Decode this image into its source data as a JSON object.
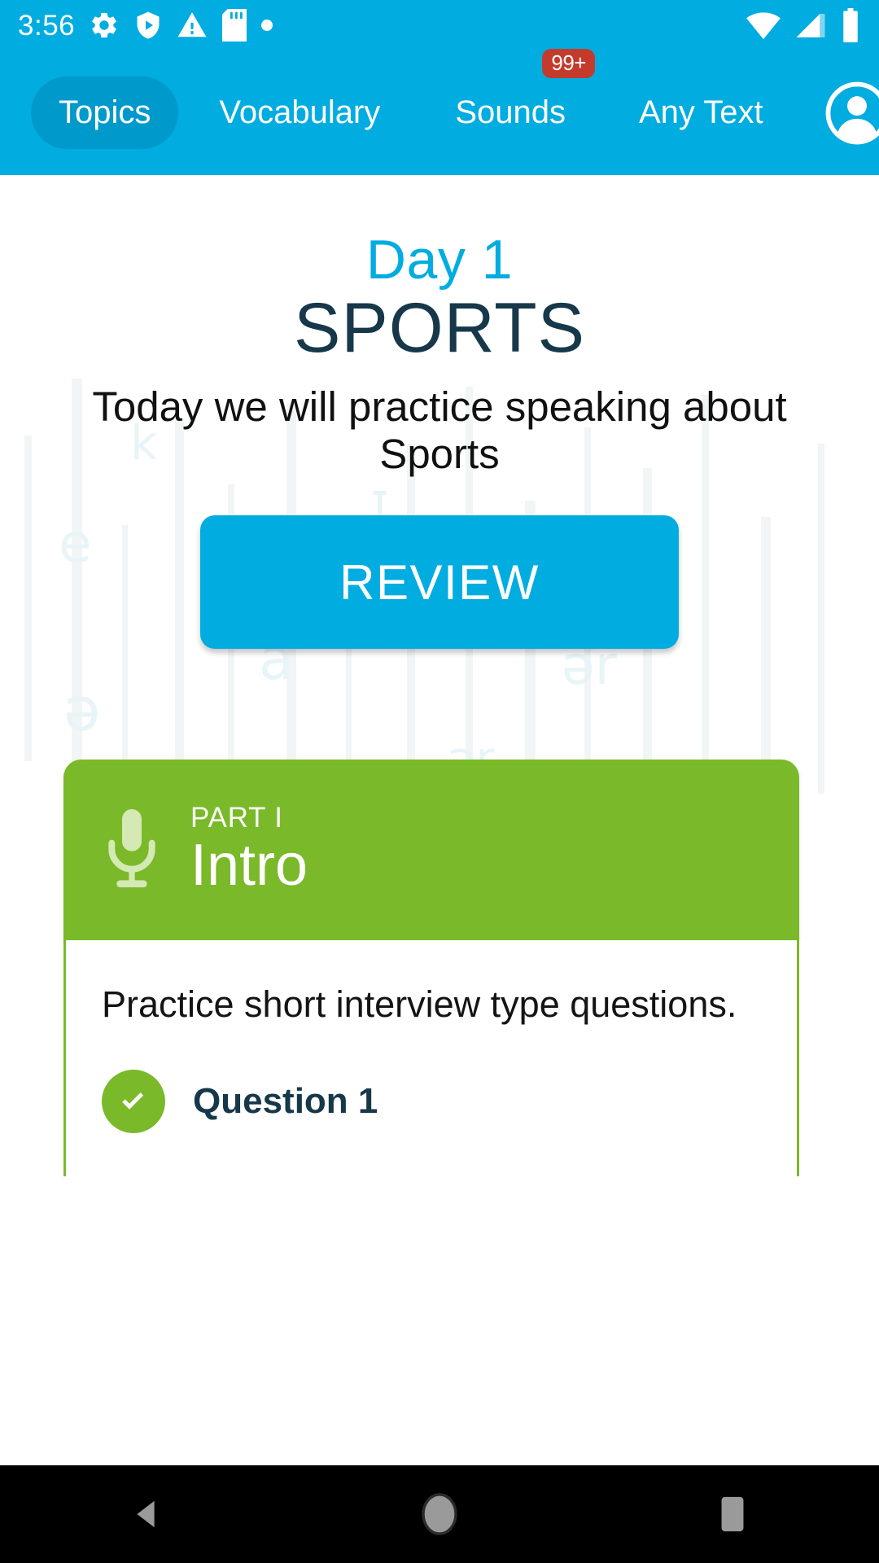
{
  "status_bar": {
    "time": "3:56",
    "left_icons": [
      "gear-icon",
      "play-protect-shield-icon",
      "warning-triangle-icon",
      "sd-card-icon",
      "dot-icon"
    ],
    "right_icons": [
      "wifi-icon",
      "cell-signal-icon",
      "battery-icon"
    ],
    "background_color": "#00ace0"
  },
  "nav": {
    "items": [
      {
        "label": "Topics",
        "active": true,
        "badge": ""
      },
      {
        "label": "Vocabulary",
        "active": false,
        "badge": ""
      },
      {
        "label": "Sounds",
        "active": false,
        "badge": "99+"
      },
      {
        "label": "Any Text",
        "active": false,
        "badge": ""
      }
    ],
    "avatar_icon": "account-circle-icon",
    "active_pill_color": "#0099cc",
    "badge_color": "#c43a2b"
  },
  "lesson": {
    "day_label": "Day 1",
    "topic": "SPORTS",
    "subtitle": "Today we will practice speaking about Sports",
    "review_button": "REVIEW",
    "day_color": "#00ace0",
    "topic_color": "#16384a",
    "button_color": "#00ace0"
  },
  "part_card": {
    "kicker": "PART I",
    "title": "Intro",
    "icon": "microphone-icon",
    "description": "Practice short interview type questions.",
    "header_color": "#7ab929",
    "questions": [
      {
        "label": "Question 1",
        "completed": true
      }
    ]
  },
  "watermark": {
    "glyphs": [
      "k",
      "ə",
      "e",
      "a",
      "ər",
      "ɪ"
    ]
  },
  "system_nav": {
    "buttons": [
      "back-button",
      "home-button",
      "recents-button"
    ],
    "background_color": "#000000"
  }
}
